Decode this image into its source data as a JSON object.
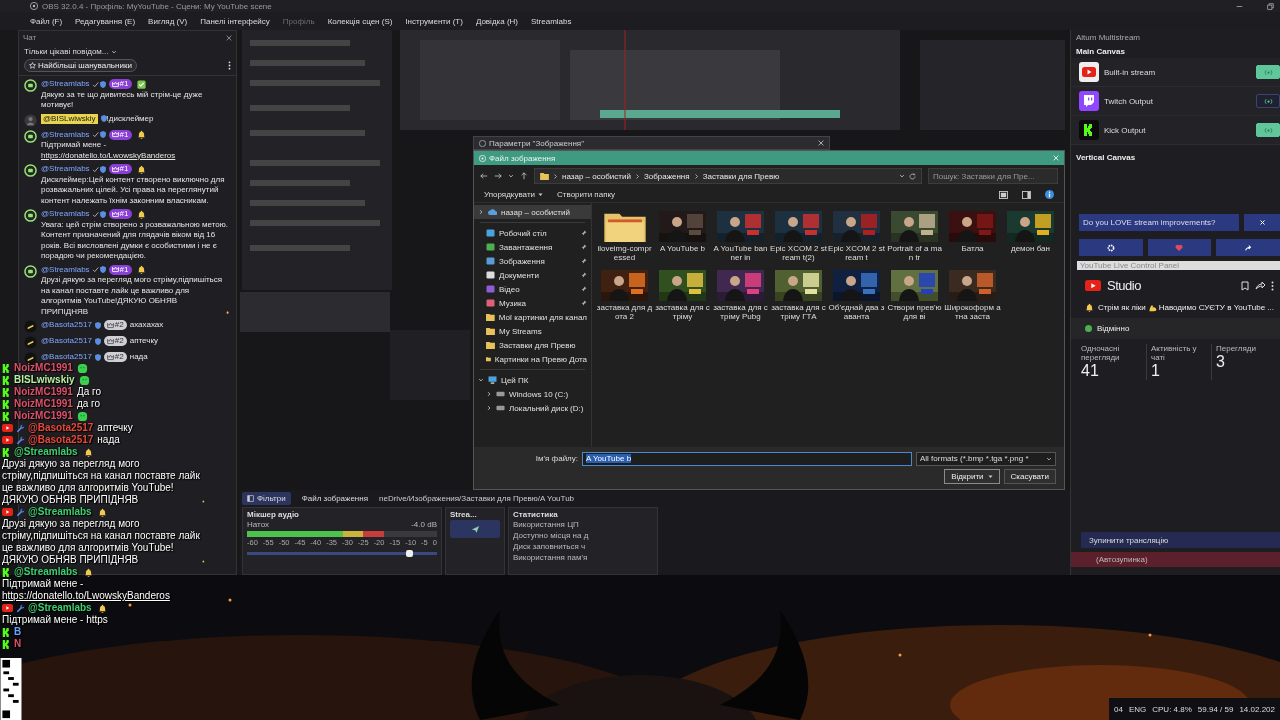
{
  "window": {
    "title": "OBS 32.0.4 - Профіль: MyYouTube - Сцени: My YouTube scene"
  },
  "menu": [
    {
      "label": "Файл (F)",
      "disabled": false
    },
    {
      "label": "Редагування (E)",
      "disabled": false
    },
    {
      "label": "Вигляд (V)",
      "disabled": false
    },
    {
      "label": "Панелі інтерфейсу",
      "disabled": false
    },
    {
      "label": "Профіль",
      "disabled": true
    },
    {
      "label": "Колекція сцен (S)",
      "disabled": false
    },
    {
      "label": "Інструменти (T)",
      "disabled": false
    },
    {
      "label": "Довідка (H)",
      "disabled": false
    },
    {
      "label": "Streamlabs",
      "disabled": false
    }
  ],
  "chat": {
    "title": "Чат",
    "filter": "Тільки цікаві повідом...",
    "top_fans": "Найбільші шанувальники",
    "messages": [
      {
        "author": "@Streamlabs",
        "kind": "bot",
        "badge": "#1",
        "highlighted": false,
        "parts": [
          {
            "kind": "check"
          },
          {
            "kind": "text",
            "text": "Дякую за те що дивитесь мій стрім-це дуже мотивує!"
          }
        ]
      },
      {
        "author": "@BISLwiwskiy",
        "kind": "viewer",
        "highlighted": true,
        "parts": [
          {
            "kind": "text",
            "text": "!дисклеймер"
          }
        ]
      },
      {
        "author": "@Streamlabs",
        "kind": "bot",
        "badge": "#1",
        "highlighted": false,
        "parts": [
          {
            "kind": "bell"
          },
          {
            "kind": "text",
            "text": "Підтримай мене - "
          },
          {
            "kind": "link",
            "text": "https://donatello.to/LwowskyBanderos"
          }
        ]
      },
      {
        "author": "@Streamlabs",
        "kind": "bot",
        "badge": "#1",
        "highlighted": false,
        "parts": [
          {
            "kind": "bell"
          },
          {
            "kind": "text",
            "text": "Дисклеймер:Цей контент створено виключно для розважальних цілей. Усі права на переглянутий контент належать їхнім законним власникам."
          }
        ]
      },
      {
        "author": "@Streamlabs",
        "kind": "bot",
        "badge": "#1",
        "highlighted": false,
        "parts": [
          {
            "kind": "bell"
          },
          {
            "kind": "text",
            "text": "Увага: цей стрім створено з розважальною метою. Контент призначений для глядачів віком від 16 років. Всі висловлені думки є особистими і не є порадою чи рекомендацією."
          }
        ]
      },
      {
        "author": "@Streamlabs",
        "kind": "bot",
        "badge": "#1",
        "highlighted": false,
        "parts": [
          {
            "kind": "bell"
          },
          {
            "kind": "text",
            "text": "Друзі дякую за перегляд мого стріму,підпишіться на канал поставте лайк це важливо для алгоритмів YouTube!ДЯКУЮ ОБНЯВ ПРИПІДНЯВ"
          },
          {
            "kind": "bell"
          }
        ]
      },
      {
        "author": "@Basota2517",
        "kind": "fan",
        "badge": "#2",
        "highlighted": false,
        "parts": [
          {
            "kind": "text",
            "text": "ахахахах"
          }
        ]
      },
      {
        "author": "@Basota2517",
        "kind": "fan",
        "badge": "#2",
        "highlighted": false,
        "parts": [
          {
            "kind": "text",
            "text": "аптечку"
          }
        ]
      },
      {
        "author": "@Basota2517",
        "kind": "fan",
        "badge": "#2",
        "highlighted": false,
        "parts": [
          {
            "kind": "text",
            "text": "нада"
          }
        ]
      }
    ]
  },
  "overlay_chat": [
    {
      "kind": "kick",
      "author": "NoizMC1991",
      "color": "#e0506a",
      "moderator": false,
      "emote": true
    },
    {
      "kind": "kick",
      "author": "BISLwiwskiy",
      "color": "#b8f0a0",
      "moderator": false,
      "emote": true
    },
    {
      "kind": "kick",
      "author": "NoizMC1991",
      "color": "#e0506a",
      "moderator": false,
      "emote": false,
      "parts": [
        {
          "kind": "text",
          "text": "Да го"
        }
      ]
    },
    {
      "kind": "kick",
      "author": "NoizMC1991",
      "color": "#e0506a",
      "moderator": false,
      "emote": false,
      "parts": [
        {
          "kind": "text",
          "text": "да го"
        }
      ]
    },
    {
      "kind": "kick",
      "author": "NoizMC1991",
      "color": "#e0506a",
      "moderator": false,
      "emote": true
    },
    {
      "kind": "youtube",
      "author": "@Basota2517",
      "color": "#e8483a",
      "moderator": true,
      "emote": false,
      "parts": [
        {
          "kind": "text",
          "text": "аптечку"
        }
      ]
    },
    {
      "kind": "youtube",
      "author": "@Basota2517",
      "color": "#e8483a",
      "moderator": true,
      "emote": false,
      "parts": [
        {
          "kind": "text",
          "text": "нада"
        }
      ]
    },
    {
      "kind": "kick",
      "author": "@Streamlabs",
      "color": "#3ecf6e",
      "moderator": false,
      "emote": false,
      "parts": [
        {
          "kind": "bell"
        },
        {
          "kind": "text",
          "text": "Друзі дякую за перегляд мого стріму,підпишіться на канал поставте лайк це важливо для алгоритмів YouTube!ДЯКУЮ ОБНЯВ ПРИПІДНЯВ"
        },
        {
          "kind": "bell"
        }
      ]
    },
    {
      "kind": "youtube",
      "author": "@Streamlabs",
      "color": "#3ecf6e",
      "moderator": true,
      "emote": false,
      "parts": [
        {
          "kind": "bell"
        },
        {
          "kind": "text",
          "text": "Друзі дякую за перегляд мого стріму,підпишіться на канал поставте лайк це важливо для алгоритмів YouTube!ДЯКУЮ ОБНЯВ ПРИПІДНЯВ"
        },
        {
          "kind": "bell"
        }
      ]
    },
    {
      "kind": "kick",
      "author": "@Streamlabs",
      "color": "#3ecf6e",
      "moderator": false,
      "emote": false,
      "parts": [
        {
          "kind": "bell"
        },
        {
          "kind": "text",
          "text": "Підтримай мене - "
        },
        {
          "kind": "link",
          "text": "https://donatello.to/LwowskyBanderos"
        }
      ]
    },
    {
      "kind": "youtube",
      "author": "@Streamlabs",
      "color": "#3ecf6e",
      "moderator": true,
      "emote": false,
      "parts": [
        {
          "kind": "bell"
        },
        {
          "kind": "text",
          "text": "Підтримай мене - https"
        }
      ]
    },
    {
      "kind": "kick",
      "author": "B",
      "color": "#6aa0ff",
      "moderator": false,
      "emote": false
    },
    {
      "kind": "kick",
      "author": "N",
      "color": "#e0506a",
      "moderator": false,
      "emote": false
    }
  ],
  "properties_window": {
    "title": "Параметри \"Зображення\""
  },
  "file_dialog": {
    "title": "Файл зображення",
    "breadcrumb": [
      "назар – особистий",
      "Зображення",
      "Заставки для Превю"
    ],
    "search": {
      "placeholder": "Пошук: Заставки для Пре..."
    },
    "toolbar": [
      {
        "label": "Упорядкувати",
        "dropdown": true
      },
      {
        "label": "Створити папку",
        "dropdown": false
      }
    ],
    "sidebar": {
      "cloud": {
        "label": "назар – особистий",
        "selected": true
      },
      "quick_access": [
        {
          "label": "Робочий стіл",
          "kind": "desktop",
          "pinned": true
        },
        {
          "label": "Завантаження",
          "kind": "download",
          "pinned": true
        },
        {
          "label": "Зображення",
          "kind": "pictures",
          "pinned": true
        },
        {
          "label": "Документи",
          "kind": "documents",
          "pinned": true
        },
        {
          "label": "Відео",
          "kind": "video",
          "pinned": true
        },
        {
          "label": "Музика",
          "kind": "music",
          "pinned": true
        },
        {
          "label": "Мої картинки для канал",
          "kind": "folder",
          "pinned": false
        },
        {
          "label": "My Streams",
          "kind": "folder",
          "pinned": false
        },
        {
          "label": "Заставки для Превю",
          "kind": "folder",
          "pinned": false
        },
        {
          "label": "Картинки на Превю Дота",
          "kind": "folder",
          "pinned": false
        }
      ],
      "this_pc": {
        "label": "Цей ПК",
        "expanded": true,
        "children": [
          {
            "label": "Windows 10 (C:)",
            "expanded": false
          },
          {
            "label": "Локальний диск (D:)",
            "expanded": false
          }
        ]
      }
    },
    "files": [
      {
        "name": "iloveimg-compressed",
        "kind": "folder"
      },
      {
        "name": "A YouTube b",
        "kind": "picture"
      },
      {
        "name": "A YouTube banner in",
        "kind": "picture"
      },
      {
        "name": "Epic XCOM 2 stream t(2)",
        "kind": "picture"
      },
      {
        "name": "Epic XCOM 2 stream t",
        "kind": "picture"
      },
      {
        "name": "Portrait of a man tr",
        "kind": "picture"
      },
      {
        "name": "Батла",
        "kind": "picture"
      },
      {
        "name": "демон бан",
        "kind": "picture"
      },
      {
        "name": "заставка для дота 2",
        "kind": "picture"
      },
      {
        "name": "заставка для стріму",
        "kind": "picture"
      },
      {
        "name": "заставка для стріму Pubg",
        "kind": "picture"
      },
      {
        "name": "заставка для стріму ГТА",
        "kind": "picture"
      },
      {
        "name": "Об'єднай два заванта",
        "kind": "picture"
      },
      {
        "name": "Створи прев'ю для ві",
        "kind": "picture"
      },
      {
        "name": "Широкоформ атна заста",
        "kind": "picture"
      }
    ],
    "filename_label": "Ім'я файлу:",
    "filename": "A YouTube b",
    "filter": "All formats (*.bmp *.tga *.png *",
    "buttons": [
      {
        "label": "Відкрити",
        "kind": "split"
      },
      {
        "label": "Скасувати",
        "kind": "plain"
      }
    ]
  },
  "docks": {
    "source_tabs": [
      {
        "label": "Фільтри",
        "kind": "filters"
      },
      {
        "label": "Файл зображення",
        "kind": "plain"
      }
    ],
    "source_path": "neDrive/Изображения/Заставки для Превю/A YouTub",
    "mixer": {
      "title": "Мікшер аудіо",
      "channel": "Натох",
      "reading": "-4.0 dB",
      "scale": [
        "-60",
        "-55",
        "-50",
        "-45",
        "-40",
        "-35",
        "-30",
        "-25",
        "-20",
        "-15",
        "-10",
        "-5",
        "0"
      ],
      "meter": {
        "level": 0.72
      },
      "volume": {
        "level": 0.86
      }
    },
    "stream_dock": {
      "title": "Strea..."
    },
    "stats": {
      "title": "Статистика",
      "rows": [
        "Використання ЦП",
        "Доступно місця на д",
        "Диск заповниться ч",
        "Використання пам'я"
      ]
    }
  },
  "multistream": {
    "title": "Aitum Multistream",
    "main_canvas": "Main Canvas",
    "outputs": [
      {
        "name": "Built-in stream",
        "kind": "youtube",
        "on": true
      },
      {
        "name": "Twitch Output",
        "kind": "twitch",
        "on": false
      },
      {
        "name": "Kick Output",
        "kind": "kick",
        "on": true
      }
    ],
    "vertical_canvas": "Vertical Canvas",
    "survey": "Do you LOVE stream improvements?"
  },
  "youtube_panel": {
    "header": "YouTube Live Control Panel",
    "brand": "Studio",
    "title_parts": [
      {
        "kind": "bell"
      },
      {
        "kind": "text",
        "text": "Стрім як ліки"
      },
      {
        "kind": "muscle"
      },
      {
        "kind": "text",
        "text": "Наводимо СУЄТУ в YouTube ..."
      }
    ],
    "health": "Відмінно",
    "stats": [
      {
        "label": "Одночасні перегляди",
        "value": "41"
      },
      {
        "label": "Активність у чаті",
        "value": "1"
      },
      {
        "label": "Перегляди",
        "value": "3"
      }
    ]
  },
  "stream_controls": {
    "stop": "Зупинити трансляцію",
    "autostop": "(Автозупинка)"
  },
  "tray": {
    "time": "04",
    "lang": "ENG",
    "cpu": "CPU: 4.8%",
    "fps": "59.94 / 59",
    "date": "14.02.202"
  }
}
